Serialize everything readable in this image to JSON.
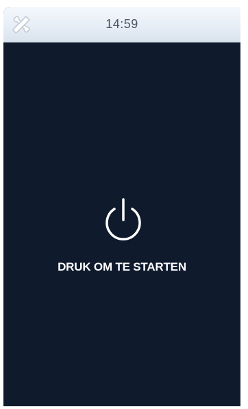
{
  "status_bar": {
    "time": "14:59",
    "tools_icon": "tools-icon"
  },
  "main": {
    "power_icon": "power-icon",
    "start_label": "DRUK OM TE STARTEN"
  },
  "colors": {
    "screen_background": "#0f1a2c",
    "topbar_background": "#e7eef6",
    "clock_text": "#4b5563",
    "label_text": "#ffffff"
  }
}
